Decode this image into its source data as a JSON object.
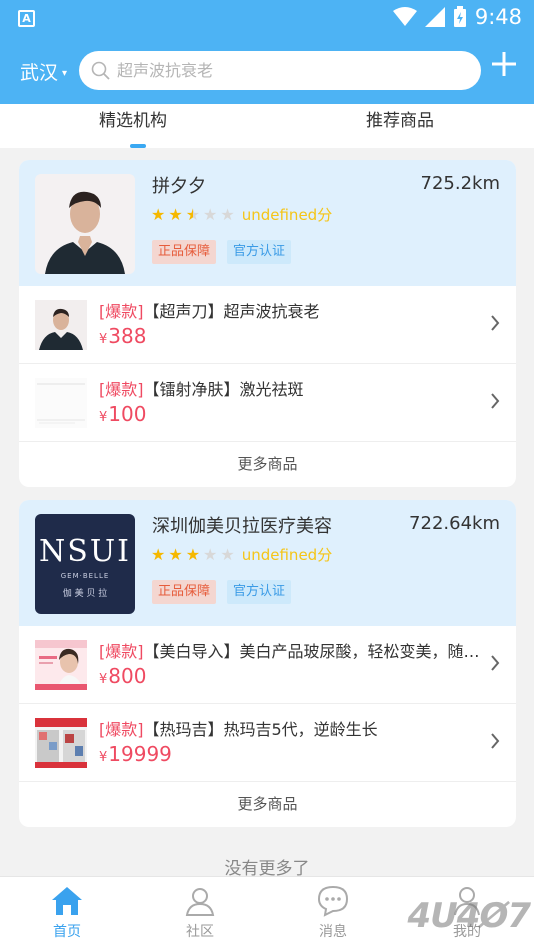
{
  "status_bar": {
    "app_letter": "A",
    "time": "9:48"
  },
  "header": {
    "city": "武汉",
    "search_placeholder": "超声波抗衰老"
  },
  "tabs": [
    {
      "label": "精选机构",
      "active": true
    },
    {
      "label": "推荐商品",
      "active": false
    }
  ],
  "shops": [
    {
      "name": "拼夕夕",
      "distance": "725.2km",
      "rating": 2.5,
      "score_text": "undefined分",
      "tags": [
        "正品保障",
        "官方认证"
      ],
      "products": [
        {
          "hot": "[爆款]",
          "title": "【超声刀】超声波抗衰老",
          "currency": "¥",
          "price": "388"
        },
        {
          "hot": "[爆款]",
          "title": "【镭射净肤】激光祛斑",
          "currency": "¥",
          "price": "100"
        }
      ],
      "more_label": "更多商品"
    },
    {
      "name": "深圳伽美贝拉医疗美容",
      "distance": "722.64km",
      "rating": 3,
      "score_text": "undefined分",
      "logo_text": "NSUI",
      "logo_sub": "GEM·BELLE",
      "logo_cn": "伽 美 贝 拉",
      "tags": [
        "正品保障",
        "官方认证"
      ],
      "products": [
        {
          "hot": "[爆款]",
          "title": "【美白导入】美白产品玻尿酸，轻松变美，随时随地",
          "currency": "¥",
          "price": "800"
        },
        {
          "hot": "[爆款]",
          "title": "【热玛吉】热玛吉5代，逆龄生长",
          "currency": "¥",
          "price": "19999"
        }
      ],
      "more_label": "更多商品"
    }
  ],
  "no_more_label": "没有更多了",
  "bottom_nav": [
    {
      "label": "首页",
      "active": true
    },
    {
      "label": "社区",
      "active": false
    },
    {
      "label": "消息",
      "active": false
    },
    {
      "label": "我的",
      "active": false
    }
  ],
  "watermark": "4U4Ø7",
  "colors": {
    "primary": "#4db3f4",
    "price": "#ef4a61",
    "star": "#f5b800",
    "shop_bg": "#dff0fd"
  }
}
